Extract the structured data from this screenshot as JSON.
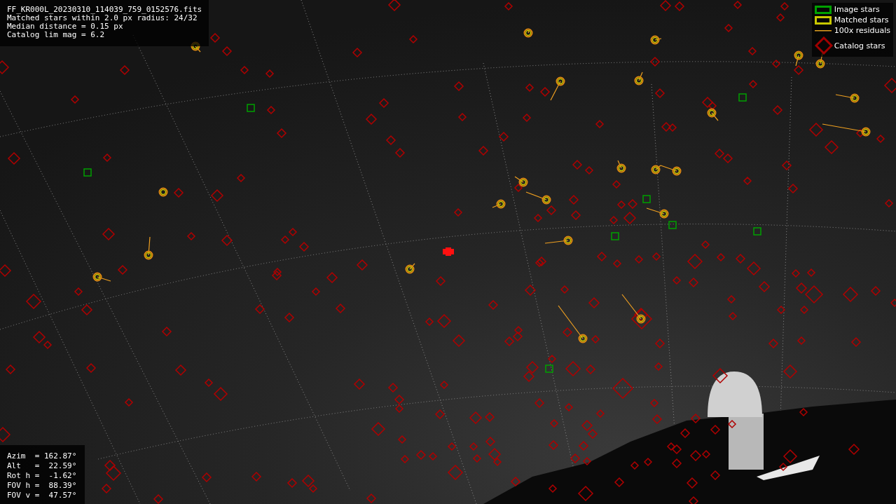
{
  "file_info": [
    "FF_KR000L_20230310_114039_759_0152576.fits",
    "Matched stars within 2.0 px radius: 24/32",
    "Median distance = 0.15 px",
    "Catalog lim mag = 6.2"
  ],
  "legend": [
    {
      "kind": "image",
      "label": "Image stars"
    },
    {
      "kind": "matched",
      "label": "Matched stars"
    },
    {
      "kind": "residual",
      "label": "100x residuals"
    },
    {
      "kind": "catalog",
      "label": "Catalog stars"
    }
  ],
  "pointing": [
    "Azim  = 162.87°",
    "Alt   =  22.59°",
    "Rot h =  -1.62°",
    "FOV h =  88.39°",
    "FOV v =  47.57°"
  ]
}
